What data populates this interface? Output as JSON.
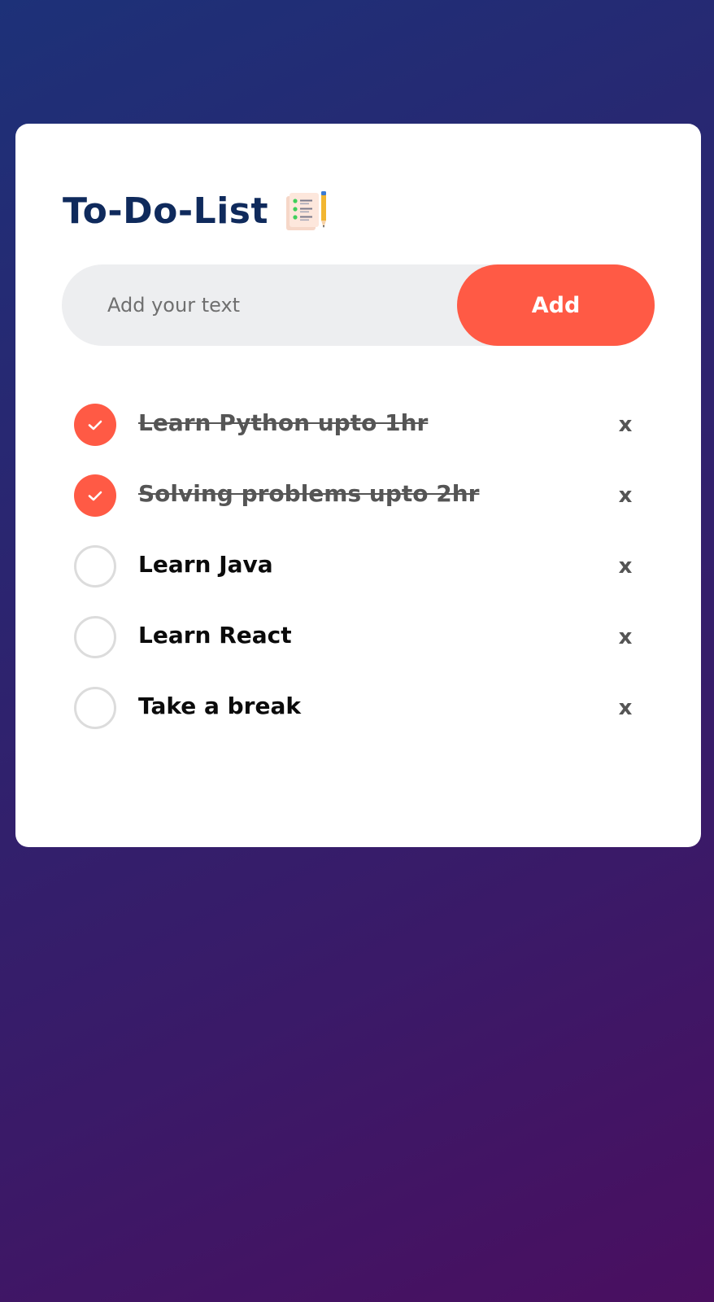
{
  "app": {
    "title": "To-Do-List",
    "title_icon": "checklist-notepad-icon"
  },
  "input": {
    "placeholder": "Add your text",
    "value": "",
    "add_label": "Add"
  },
  "todos": [
    {
      "text": "Learn Python upto 1hr",
      "done": true,
      "delete_label": "x"
    },
    {
      "text": "Solving problems upto 2hr",
      "done": true,
      "delete_label": "x"
    },
    {
      "text": "Learn Java",
      "done": false,
      "delete_label": "x"
    },
    {
      "text": "Learn React",
      "done": false,
      "delete_label": "x"
    },
    {
      "text": "Take a break",
      "done": false,
      "delete_label": "x"
    }
  ],
  "colors": {
    "accent": "#ff5a45",
    "title": "#0f2a5c",
    "input_bg": "#edeef0",
    "done_text": "#555555"
  }
}
